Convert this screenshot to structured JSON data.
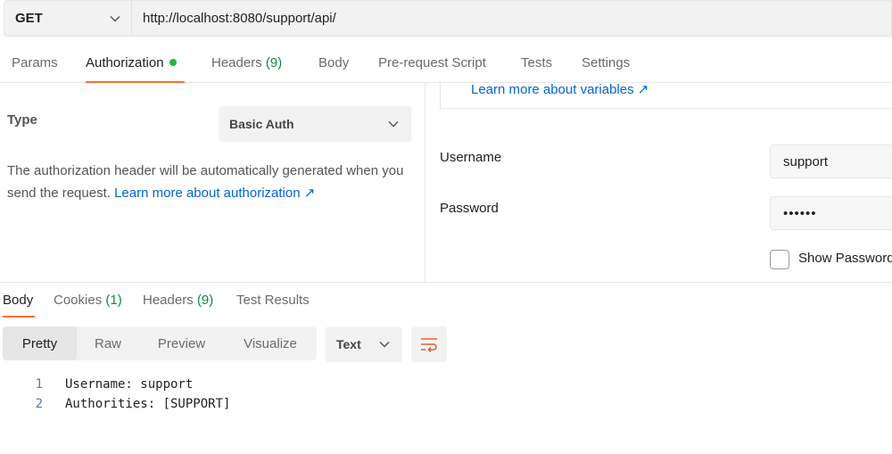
{
  "request": {
    "method": "GET",
    "url": "http://localhost:8080/support/api/"
  },
  "request_tabs": [
    {
      "label": "Params"
    },
    {
      "label": "Authorization"
    },
    {
      "label": "Headers",
      "count": "(9)"
    },
    {
      "label": "Body"
    },
    {
      "label": "Pre-request Script"
    },
    {
      "label": "Tests"
    },
    {
      "label": "Settings"
    }
  ],
  "auth": {
    "type_label": "Type",
    "type_value": "Basic Auth",
    "description": "The authorization header will be automatically generated when you send the request.",
    "learn_more_auth": "Learn more about authorization ↗",
    "learn_more_vars": "Learn more about variables ↗",
    "username_label": "Username",
    "username_value": "support",
    "password_label": "Password",
    "password_value": "••••••",
    "show_password_label": "Show Password"
  },
  "response_tabs": [
    {
      "label": "Body"
    },
    {
      "label": "Cookies",
      "count": "(1)"
    },
    {
      "label": "Headers",
      "count": "(9)"
    },
    {
      "label": "Test Results"
    }
  ],
  "view_modes": [
    "Pretty",
    "Raw",
    "Preview",
    "Visualize"
  ],
  "format": "Text",
  "response_body": [
    {
      "line": "1",
      "text": "Username: support"
    },
    {
      "line": "2",
      "text": "Authorities: [SUPPORT]"
    }
  ],
  "colors": {
    "accent": "#ff6c37",
    "link": "#0265d2",
    "count_green": "#0b8a3e",
    "dot_green": "#26b34a"
  },
  "icons": [
    "chevron-down-icon",
    "wrap-lines-icon",
    "external-link-icon"
  ]
}
